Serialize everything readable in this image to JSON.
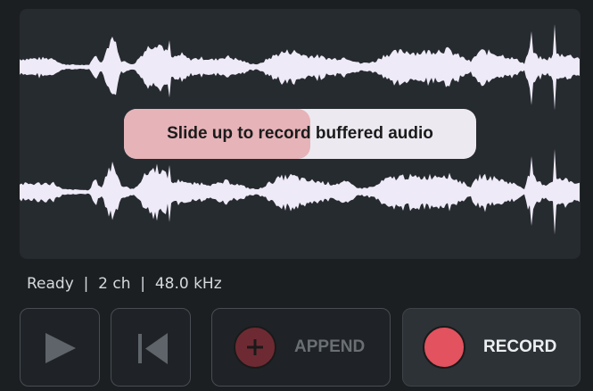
{
  "waveform": {
    "channels": 2,
    "color": "#eeeaf7",
    "background": "#262b30",
    "recorded_fraction": 0.53
  },
  "hint": {
    "text": "Slide up to record buffered audio",
    "fill_color": "#e6b3b8"
  },
  "status": {
    "state": "Ready",
    "channels": "2 ch",
    "sample_rate": "48.0 kHz"
  },
  "controls": {
    "play_icon": "play-icon",
    "rewind_icon": "skip-to-start-icon",
    "append_label": "APPEND",
    "append_icon": "plus-circle-icon",
    "record_label": "RECORD",
    "record_icon": "record-circle-icon",
    "record_color": "#e2525f"
  }
}
